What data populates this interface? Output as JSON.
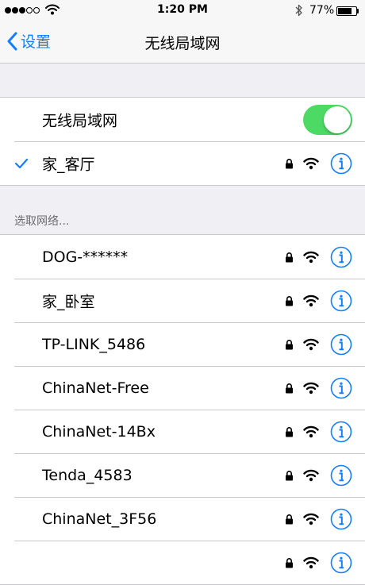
{
  "status_bar": {
    "time": "1:20 PM",
    "battery": "77%",
    "battery_level": 0.77,
    "signal_dots": [
      true,
      true,
      true,
      false,
      false
    ]
  },
  "nav": {
    "back_label": "设置",
    "title": "无线局域网"
  },
  "wifi_toggle": {
    "label": "无线局域网",
    "on": true
  },
  "connected": {
    "name": "家_客厅"
  },
  "section_header": "选取网络...",
  "networks": [
    {
      "name": "DOG-******"
    },
    {
      "name": "家_卧室"
    },
    {
      "name": "TP-LINK_5486"
    },
    {
      "name": "ChinaNet-Free"
    },
    {
      "name": "ChinaNet-14Bx"
    },
    {
      "name": "Tenda_4583"
    },
    {
      "name": "ChinaNet_3F56"
    },
    {
      "name": ""
    }
  ],
  "colors": {
    "accent": "#147efb",
    "toggle_on": "#4cd964",
    "background": "#efeff4"
  }
}
